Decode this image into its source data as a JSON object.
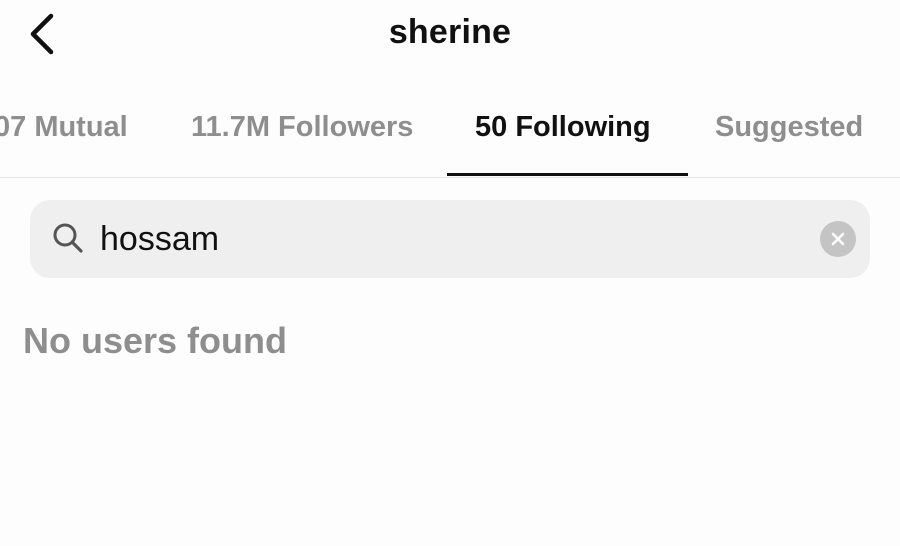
{
  "header": {
    "title": "sherine",
    "back_icon": "chevron-left-icon"
  },
  "tabs": [
    {
      "label": "07 Mutual",
      "active": false
    },
    {
      "label": "11.7M Followers",
      "active": false
    },
    {
      "label": "50 Following",
      "active": true
    },
    {
      "label": "Suggested",
      "active": false
    }
  ],
  "search": {
    "icon": "search-icon",
    "value": "hossam",
    "clear_icon": "clear-icon"
  },
  "results": {
    "empty_message": "No users found"
  },
  "colors": {
    "text_primary": "#111111",
    "text_secondary": "#8e8e8e",
    "search_bg": "#efefef",
    "clear_bg": "#c4c4c4"
  }
}
